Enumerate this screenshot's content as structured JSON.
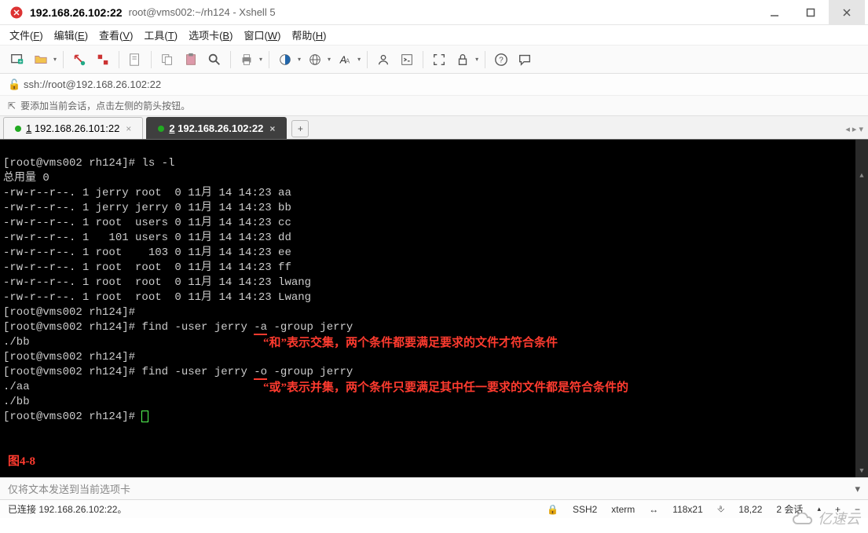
{
  "title": "192.168.26.102:22",
  "subtitle": "root@vms002:~/rh124 - Xshell 5",
  "menubar": [
    {
      "label": "文件",
      "key": "F"
    },
    {
      "label": "编辑",
      "key": "E"
    },
    {
      "label": "查看",
      "key": "V"
    },
    {
      "label": "工具",
      "key": "T"
    },
    {
      "label": "选项卡",
      "key": "B"
    },
    {
      "label": "窗口",
      "key": "W"
    },
    {
      "label": "帮助",
      "key": "H"
    }
  ],
  "address": "ssh://root@192.168.26.102:22",
  "hint": "要添加当前会话，点击左侧的箭头按钮。",
  "tabs": [
    {
      "num": "1",
      "label": "192.168.26.101:22",
      "active": false
    },
    {
      "num": "2",
      "label": "192.168.26.102:22",
      "active": true
    }
  ],
  "term": {
    "prompt": "[root@vms002 rh124]#",
    "cmd_ls": "ls -l",
    "total": "总用量 0",
    "rows": [
      "-rw-r--r--. 1 jerry root  0 11月 14 14:23 aa",
      "-rw-r--r--. 1 jerry jerry 0 11月 14 14:23 bb",
      "-rw-r--r--. 1 root  users 0 11月 14 14:23 cc",
      "-rw-r--r--. 1   101 users 0 11月 14 14:23 dd",
      "-rw-r--r--. 1 root    103 0 11月 14 14:23 ee",
      "-rw-r--r--. 1 root  root  0 11月 14 14:23 ff",
      "-rw-r--r--. 1 root  root  0 11月 14 14:23 lwang",
      "-rw-r--r--. 1 root  root  0 11月 14 14:23 Lwang"
    ],
    "cmd_find_pre": "find -user jerry ",
    "flag_a": "-a",
    "flag_o": "-o",
    "cmd_find_post": " -group jerry",
    "out_bb": "./bb",
    "out_aa": "./aa",
    "anno1": "“和”表示交集，两个条件都要满足要求的文件才符合条件",
    "anno2": "“或”表示并集，两个条件只要满足其中任一要求的文件都是符合条件的",
    "figlabel": "图4-8"
  },
  "sendbar": "仅将文本发送到当前选项卡",
  "status": {
    "conn": "已连接 192.168.26.102:22。",
    "proto": "SSH2",
    "ttype": "xterm",
    "size": "118x21",
    "pos": "18,22",
    "sess": "2 会话"
  },
  "watermark": "亿速云"
}
